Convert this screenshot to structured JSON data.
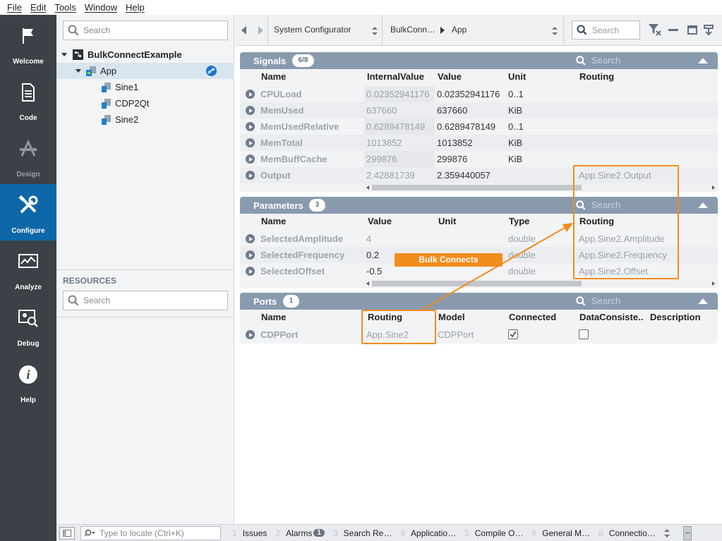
{
  "menu": [
    "File",
    "Edit",
    "Tools",
    "Window",
    "Help"
  ],
  "modes": [
    {
      "label": "Welcome",
      "icon": "flag-icon",
      "state": "normal"
    },
    {
      "label": "Code",
      "icon": "document-icon",
      "state": "normal"
    },
    {
      "label": "Design",
      "icon": "design-icon",
      "state": "disabled"
    },
    {
      "label": "Configure",
      "icon": "tools-icon",
      "state": "active"
    },
    {
      "label": "Analyze",
      "icon": "chart-monitor-icon",
      "state": "normal"
    },
    {
      "label": "Debug",
      "icon": "debug-icon",
      "state": "normal"
    },
    {
      "label": "Help",
      "icon": "info-icon",
      "state": "normal"
    }
  ],
  "navigator": {
    "search_placeholder": "Search",
    "tree": {
      "root": "BulkConnectExample",
      "app": "App",
      "children": [
        "Sine1",
        "CDP2Qt",
        "Sine2"
      ]
    },
    "resources_label": "RESOURCES",
    "resources_search_placeholder": "Search"
  },
  "toolbar": {
    "view_selector": "System Configurator",
    "breadcrumb_parent": "BulkConn…",
    "breadcrumb_current": "App",
    "search_placeholder": "Search"
  },
  "signals": {
    "title": "Signals",
    "badge": "6/8",
    "search_placeholder": "Search",
    "columns": [
      "Name",
      "InternalValue",
      "Value",
      "Unit",
      "Routing"
    ],
    "rows": [
      {
        "name": "CPULoad",
        "internal": "0.02352941176",
        "value": "0.02352941176",
        "unit": "0..1",
        "routing": ""
      },
      {
        "name": "MemUsed",
        "internal": "637660",
        "value": "637660",
        "unit": "KiB",
        "routing": ""
      },
      {
        "name": "MemUsedRelative",
        "internal": "0.6289478149",
        "value": "0.6289478149",
        "unit": "0..1",
        "routing": ""
      },
      {
        "name": "MemTotal",
        "internal": "1013852",
        "value": "1013852",
        "unit": "KiB",
        "routing": ""
      },
      {
        "name": "MemBuffCache",
        "internal": "299876",
        "value": "299876",
        "unit": "KiB",
        "routing": ""
      },
      {
        "name": "Output",
        "internal": "2.42881739",
        "value": "2.359440057",
        "unit": "",
        "routing": "App.Sine2.Output"
      }
    ]
  },
  "parameters": {
    "title": "Parameters",
    "badge": "3",
    "search_placeholder": "Search",
    "columns": [
      "Name",
      "Value",
      "Unit",
      "Type",
      "Routing"
    ],
    "rows": [
      {
        "name": "SelectedAmplitude",
        "value": "4",
        "unit": "",
        "type": "double",
        "routing": "App.Sine2.Amplitude"
      },
      {
        "name": "SelectedFrequency",
        "value": "0.2",
        "unit": "",
        "type": "double",
        "routing": "App.Sine2.Frequency"
      },
      {
        "name": "SelectedOffset",
        "value": "-0.5",
        "unit": "",
        "type": "double",
        "routing": "App.Sine2.Offset"
      }
    ]
  },
  "ports": {
    "title": "Ports",
    "badge": "1",
    "search_placeholder": "Search",
    "columns": [
      "Name",
      "Routing",
      "Model",
      "Connected",
      "DataConsiste..",
      "Description"
    ],
    "rows": [
      {
        "name": "CDPPort",
        "routing": "App.Sine2",
        "model": "CDPPort",
        "connected": true,
        "data_consistent": false,
        "description": ""
      }
    ]
  },
  "annotation": {
    "label": "Bulk Connects",
    "color": "#f28c1d"
  },
  "statusbar": {
    "locator_placeholder": "Type to locate (Ctrl+K)",
    "tabs": [
      {
        "num": "1",
        "label": "Issues"
      },
      {
        "num": "2",
        "label": "Alarms",
        "count": "1"
      },
      {
        "num": "3",
        "label": "Search Re…"
      },
      {
        "num": "4",
        "label": "Applicatio…"
      },
      {
        "num": "5",
        "label": "Compile O…"
      },
      {
        "num": "6",
        "label": "General M…"
      },
      {
        "num": "8",
        "label": "Connectio…"
      }
    ]
  },
  "colors": {
    "accent": "#0e67a8",
    "sidebar": "#3b4146",
    "panel_header": "#8a9aae",
    "highlight": "#f28c1d"
  }
}
